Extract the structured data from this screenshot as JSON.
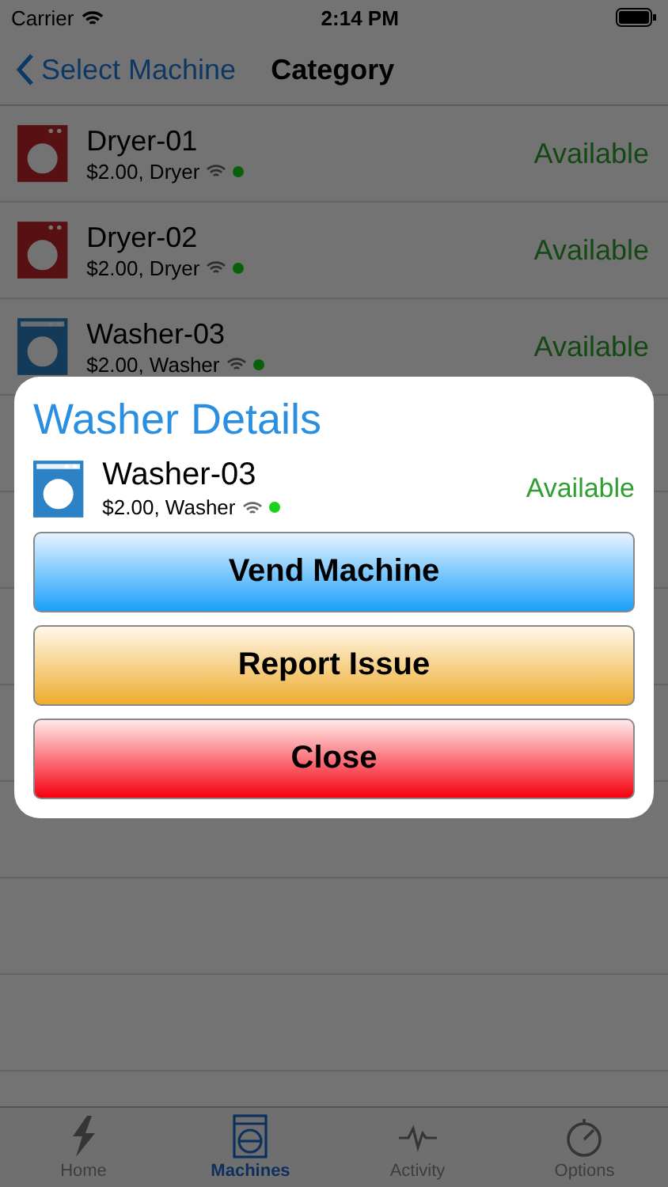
{
  "status_bar": {
    "carrier": "Carrier",
    "time": "2:14 PM"
  },
  "nav": {
    "back": "Select Machine",
    "title": "Category"
  },
  "machines": [
    {
      "name": "Dryer-01",
      "detail": "$2.00, Dryer",
      "kind": "dryer",
      "status": "Available",
      "online": true
    },
    {
      "name": "Dryer-02",
      "detail": "$2.00, Dryer",
      "kind": "dryer",
      "status": "Available",
      "online": true
    },
    {
      "name": "Washer-03",
      "detail": "$2.00, Washer",
      "kind": "washer",
      "status": "Available",
      "online": true
    }
  ],
  "dialog": {
    "title": "Washer Details",
    "machine": {
      "name": "Washer-03",
      "detail": "$2.00, Washer",
      "kind": "washer",
      "status": "Available",
      "online": true
    },
    "buttons": [
      {
        "label": "Vend Machine",
        "kind": "primary"
      },
      {
        "label": "Report Issue",
        "kind": "warning"
      },
      {
        "label": "Close",
        "kind": "danger"
      }
    ]
  },
  "tabs": [
    {
      "label": "Home",
      "kind": "bolt",
      "selected": false
    },
    {
      "label": "Machines",
      "kind": "washer",
      "selected": true
    },
    {
      "label": "Activity",
      "kind": "pulse",
      "selected": false
    },
    {
      "label": "Options",
      "kind": "timer",
      "selected": false
    }
  ]
}
